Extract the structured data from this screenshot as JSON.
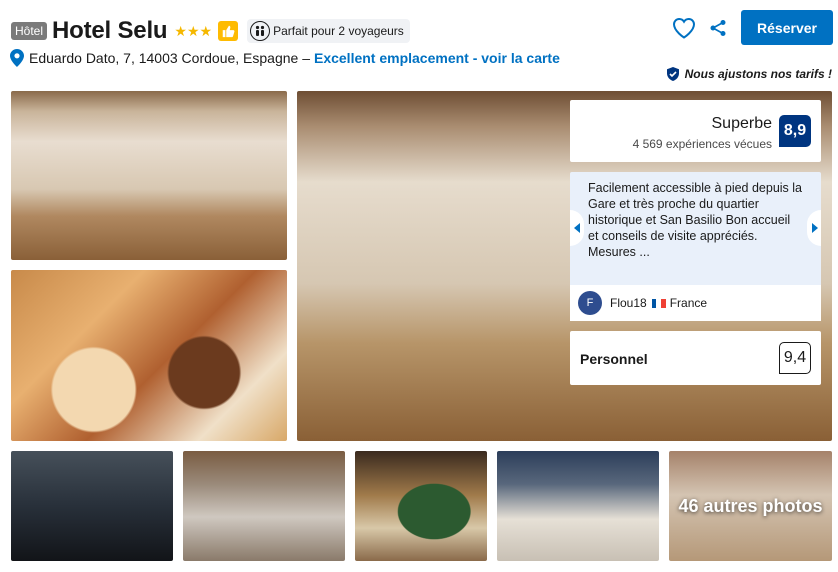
{
  "header": {
    "tag": "Hôtel",
    "name": "Hotel Selu",
    "stars": 3,
    "travellers_badge": "Parfait pour 2 voyageurs"
  },
  "address": {
    "text": "Eduardo Dato, 7, 14003 Cordoue, Espagne –",
    "link": "Excellent emplacement - voir la carte"
  },
  "actions": {
    "favorite_icon": "heart-icon",
    "share_icon": "share-icon",
    "reserve_label": "Réserver"
  },
  "price_match": "Nous ajustons nos tarifs !",
  "rating": {
    "word": "Superbe",
    "reviews": "4 569 expériences vécues",
    "score": "8,9"
  },
  "review": {
    "text": "Facilement accessible à pied depuis la Gare et très proche du quartier historique et San Basilio Bon accueil et conseils de visite appréciés. Mesures ...",
    "author_initial": "F",
    "author": "Flou18",
    "country": "France"
  },
  "staff": {
    "label": "Personnel",
    "score": "9,4"
  },
  "gallery": {
    "more_photos": "46 autres photos"
  },
  "colors": {
    "brand_blue": "#0071c2",
    "score_navy": "#003580",
    "star_yellow": "#f5b800",
    "review_bg": "#e9f0fa"
  }
}
